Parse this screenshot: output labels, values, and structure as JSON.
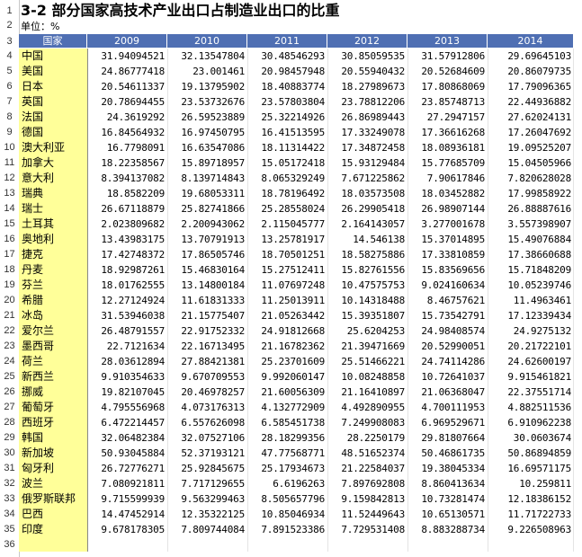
{
  "sheet": {
    "title": "3-2 部分国家高技术产业出口占制造业出口的比重",
    "unit": "单位：%",
    "header": {
      "country_label": "国家",
      "years": [
        "2009",
        "2010",
        "2011",
        "2012",
        "2013",
        "2014"
      ]
    },
    "row_numbers": [
      "1",
      "2",
      "3",
      "4",
      "5",
      "6",
      "7",
      "8",
      "9",
      "10",
      "11",
      "12",
      "13",
      "14",
      "15",
      "16",
      "17",
      "18",
      "19",
      "20",
      "21",
      "22",
      "23",
      "24",
      "25",
      "26",
      "27",
      "28",
      "29",
      "30",
      "31",
      "32",
      "33",
      "34",
      "35",
      "36"
    ],
    "rows": [
      {
        "country": "中国",
        "values": [
          "31.94094521",
          "32.13547804",
          "30.48546293",
          "30.85059535",
          "31.57912806",
          "29.69645103"
        ]
      },
      {
        "country": "美国",
        "values": [
          "24.86777418",
          "23.001461",
          "20.98457948",
          "20.55940432",
          "20.52684609",
          "20.86079735"
        ]
      },
      {
        "country": "日本",
        "values": [
          "20.54611337",
          "19.13795902",
          "18.40883774",
          "18.27989673",
          "17.80868069",
          "17.79096365"
        ]
      },
      {
        "country": "英国",
        "values": [
          "20.78694455",
          "23.53732676",
          "23.57803804",
          "23.78812206",
          "23.85748713",
          "22.44936882"
        ]
      },
      {
        "country": "法国",
        "values": [
          "24.3619292",
          "26.59523889",
          "25.32214926",
          "26.86989443",
          "27.2947157",
          "27.62024131"
        ]
      },
      {
        "country": "德国",
        "values": [
          "16.84564932",
          "16.97450795",
          "16.41513595",
          "17.33249078",
          "17.36616268",
          "17.26047692"
        ]
      },
      {
        "country": "澳大利亚",
        "values": [
          "16.7798091",
          "16.63547086",
          "18.11314422",
          "17.34872458",
          "18.08936181",
          "19.09525207"
        ]
      },
      {
        "country": "加拿大",
        "values": [
          "18.22358567",
          "15.89718957",
          "15.05172418",
          "15.93129484",
          "15.77685709",
          "15.04505966"
        ]
      },
      {
        "country": "意大利",
        "values": [
          "8.394137082",
          "8.139714843",
          "8.065329249",
          "7.671225862",
          "7.90617846",
          "7.820628028"
        ]
      },
      {
        "country": "瑞典",
        "values": [
          "18.8582209",
          "19.68053311",
          "18.78196492",
          "18.03573508",
          "18.03452882",
          "17.99858922"
        ]
      },
      {
        "country": "瑞士",
        "values": [
          "26.67118879",
          "25.82741866",
          "25.28558024",
          "26.29905418",
          "26.98907144",
          "26.88887616"
        ]
      },
      {
        "country": "土耳其",
        "values": [
          "2.023809682",
          "2.200943062",
          "2.115045777",
          "2.164143057",
          "3.277001678",
          "3.557398907"
        ]
      },
      {
        "country": "奥地利",
        "values": [
          "13.43983175",
          "13.70791913",
          "13.25781917",
          "14.546138",
          "15.37014895",
          "15.49076884"
        ]
      },
      {
        "country": "捷克",
        "values": [
          "17.42748372",
          "17.86505746",
          "18.70501251",
          "18.58275886",
          "17.33810859",
          "17.38660688"
        ]
      },
      {
        "country": "丹麦",
        "values": [
          "18.92987261",
          "15.46830164",
          "15.27512411",
          "15.82761556",
          "15.83569656",
          "15.71848209"
        ]
      },
      {
        "country": "芬兰",
        "values": [
          "18.01762555",
          "13.14800184",
          "11.07697248",
          "10.47575753",
          "9.024160634",
          "10.05239746"
        ]
      },
      {
        "country": "希腊",
        "values": [
          "12.27124924",
          "11.61831333",
          "11.25013911",
          "10.14318488",
          "8.46757621",
          "11.4963461"
        ]
      },
      {
        "country": "冰岛",
        "values": [
          "31.53946038",
          "21.15775407",
          "21.05263442",
          "15.39351807",
          "15.73542791",
          "17.12339434"
        ]
      },
      {
        "country": "爱尔兰",
        "values": [
          "26.48791557",
          "22.91752332",
          "24.91812668",
          "25.6204253",
          "24.98408574",
          "24.9275132"
        ]
      },
      {
        "country": "墨西哥",
        "values": [
          "22.7121634",
          "22.16713495",
          "21.16782362",
          "21.39471669",
          "20.52990051",
          "20.21722101"
        ]
      },
      {
        "country": "荷兰",
        "values": [
          "28.03612894",
          "27.88421381",
          "25.23701609",
          "25.51466221",
          "24.74114286",
          "24.62600197"
        ]
      },
      {
        "country": "新西兰",
        "values": [
          "9.910354633",
          "9.670709553",
          "9.992060147",
          "10.08248858",
          "10.72641037",
          "9.915461821"
        ]
      },
      {
        "country": "挪威",
        "values": [
          "19.82107045",
          "20.46978257",
          "21.60056309",
          "21.16410897",
          "21.06368047",
          "22.37551714"
        ]
      },
      {
        "country": "葡萄牙",
        "values": [
          "4.795556968",
          "4.073176313",
          "4.132772909",
          "4.492890955",
          "4.700111953",
          "4.882511536"
        ]
      },
      {
        "country": "西班牙",
        "values": [
          "6.472214457",
          "6.557626098",
          "6.585451738",
          "7.249908083",
          "6.969529671",
          "6.910962238"
        ]
      },
      {
        "country": "韩国",
        "values": [
          "32.06482384",
          "32.07527106",
          "28.18299356",
          "28.2250179",
          "29.81807664",
          "30.0603674"
        ]
      },
      {
        "country": "新加坡",
        "values": [
          "50.93045884",
          "52.37193121",
          "47.77568771",
          "48.51652374",
          "50.46861735",
          "50.86894859"
        ]
      },
      {
        "country": "匈牙利",
        "values": [
          "26.72776271",
          "25.92845675",
          "25.17934673",
          "21.22584037",
          "19.38045334",
          "16.69571175"
        ]
      },
      {
        "country": "波兰",
        "values": [
          "7.080921811",
          "7.717129655",
          "6.6196263",
          "7.897692808",
          "8.860413634",
          "10.259811"
        ]
      },
      {
        "country": "俄罗斯联邦",
        "values": [
          "9.715599939",
          "9.563299463",
          "8.505657796",
          "9.159842813",
          "10.73281474",
          "12.18386152"
        ]
      },
      {
        "country": "巴西",
        "values": [
          "14.47452914",
          "12.35322125",
          "10.85046934",
          "11.52449643",
          "10.65130571",
          "11.71722733"
        ]
      },
      {
        "country": "印度",
        "values": [
          "9.678178305",
          "7.809744084",
          "7.891523386",
          "7.729531408",
          "8.883288734",
          "9.226508963"
        ]
      }
    ]
  }
}
